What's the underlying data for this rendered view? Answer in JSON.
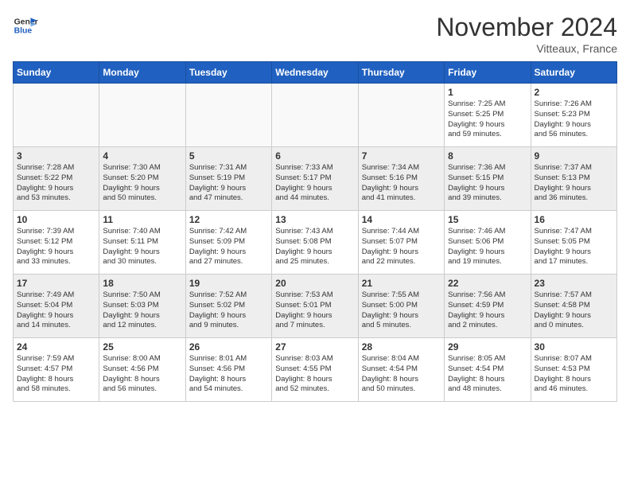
{
  "header": {
    "logo_line1": "General",
    "logo_line2": "Blue",
    "month": "November 2024",
    "location": "Vitteaux, France"
  },
  "days_of_week": [
    "Sunday",
    "Monday",
    "Tuesday",
    "Wednesday",
    "Thursday",
    "Friday",
    "Saturday"
  ],
  "weeks": [
    [
      {
        "day": "",
        "info": ""
      },
      {
        "day": "",
        "info": ""
      },
      {
        "day": "",
        "info": ""
      },
      {
        "day": "",
        "info": ""
      },
      {
        "day": "",
        "info": ""
      },
      {
        "day": "1",
        "info": "Sunrise: 7:25 AM\nSunset: 5:25 PM\nDaylight: 9 hours\nand 59 minutes."
      },
      {
        "day": "2",
        "info": "Sunrise: 7:26 AM\nSunset: 5:23 PM\nDaylight: 9 hours\nand 56 minutes."
      }
    ],
    [
      {
        "day": "3",
        "info": "Sunrise: 7:28 AM\nSunset: 5:22 PM\nDaylight: 9 hours\nand 53 minutes."
      },
      {
        "day": "4",
        "info": "Sunrise: 7:30 AM\nSunset: 5:20 PM\nDaylight: 9 hours\nand 50 minutes."
      },
      {
        "day": "5",
        "info": "Sunrise: 7:31 AM\nSunset: 5:19 PM\nDaylight: 9 hours\nand 47 minutes."
      },
      {
        "day": "6",
        "info": "Sunrise: 7:33 AM\nSunset: 5:17 PM\nDaylight: 9 hours\nand 44 minutes."
      },
      {
        "day": "7",
        "info": "Sunrise: 7:34 AM\nSunset: 5:16 PM\nDaylight: 9 hours\nand 41 minutes."
      },
      {
        "day": "8",
        "info": "Sunrise: 7:36 AM\nSunset: 5:15 PM\nDaylight: 9 hours\nand 39 minutes."
      },
      {
        "day": "9",
        "info": "Sunrise: 7:37 AM\nSunset: 5:13 PM\nDaylight: 9 hours\nand 36 minutes."
      }
    ],
    [
      {
        "day": "10",
        "info": "Sunrise: 7:39 AM\nSunset: 5:12 PM\nDaylight: 9 hours\nand 33 minutes."
      },
      {
        "day": "11",
        "info": "Sunrise: 7:40 AM\nSunset: 5:11 PM\nDaylight: 9 hours\nand 30 minutes."
      },
      {
        "day": "12",
        "info": "Sunrise: 7:42 AM\nSunset: 5:09 PM\nDaylight: 9 hours\nand 27 minutes."
      },
      {
        "day": "13",
        "info": "Sunrise: 7:43 AM\nSunset: 5:08 PM\nDaylight: 9 hours\nand 25 minutes."
      },
      {
        "day": "14",
        "info": "Sunrise: 7:44 AM\nSunset: 5:07 PM\nDaylight: 9 hours\nand 22 minutes."
      },
      {
        "day": "15",
        "info": "Sunrise: 7:46 AM\nSunset: 5:06 PM\nDaylight: 9 hours\nand 19 minutes."
      },
      {
        "day": "16",
        "info": "Sunrise: 7:47 AM\nSunset: 5:05 PM\nDaylight: 9 hours\nand 17 minutes."
      }
    ],
    [
      {
        "day": "17",
        "info": "Sunrise: 7:49 AM\nSunset: 5:04 PM\nDaylight: 9 hours\nand 14 minutes."
      },
      {
        "day": "18",
        "info": "Sunrise: 7:50 AM\nSunset: 5:03 PM\nDaylight: 9 hours\nand 12 minutes."
      },
      {
        "day": "19",
        "info": "Sunrise: 7:52 AM\nSunset: 5:02 PM\nDaylight: 9 hours\nand 9 minutes."
      },
      {
        "day": "20",
        "info": "Sunrise: 7:53 AM\nSunset: 5:01 PM\nDaylight: 9 hours\nand 7 minutes."
      },
      {
        "day": "21",
        "info": "Sunrise: 7:55 AM\nSunset: 5:00 PM\nDaylight: 9 hours\nand 5 minutes."
      },
      {
        "day": "22",
        "info": "Sunrise: 7:56 AM\nSunset: 4:59 PM\nDaylight: 9 hours\nand 2 minutes."
      },
      {
        "day": "23",
        "info": "Sunrise: 7:57 AM\nSunset: 4:58 PM\nDaylight: 9 hours\nand 0 minutes."
      }
    ],
    [
      {
        "day": "24",
        "info": "Sunrise: 7:59 AM\nSunset: 4:57 PM\nDaylight: 8 hours\nand 58 minutes."
      },
      {
        "day": "25",
        "info": "Sunrise: 8:00 AM\nSunset: 4:56 PM\nDaylight: 8 hours\nand 56 minutes."
      },
      {
        "day": "26",
        "info": "Sunrise: 8:01 AM\nSunset: 4:56 PM\nDaylight: 8 hours\nand 54 minutes."
      },
      {
        "day": "27",
        "info": "Sunrise: 8:03 AM\nSunset: 4:55 PM\nDaylight: 8 hours\nand 52 minutes."
      },
      {
        "day": "28",
        "info": "Sunrise: 8:04 AM\nSunset: 4:54 PM\nDaylight: 8 hours\nand 50 minutes."
      },
      {
        "day": "29",
        "info": "Sunrise: 8:05 AM\nSunset: 4:54 PM\nDaylight: 8 hours\nand 48 minutes."
      },
      {
        "day": "30",
        "info": "Sunrise: 8:07 AM\nSunset: 4:53 PM\nDaylight: 8 hours\nand 46 minutes."
      }
    ]
  ]
}
